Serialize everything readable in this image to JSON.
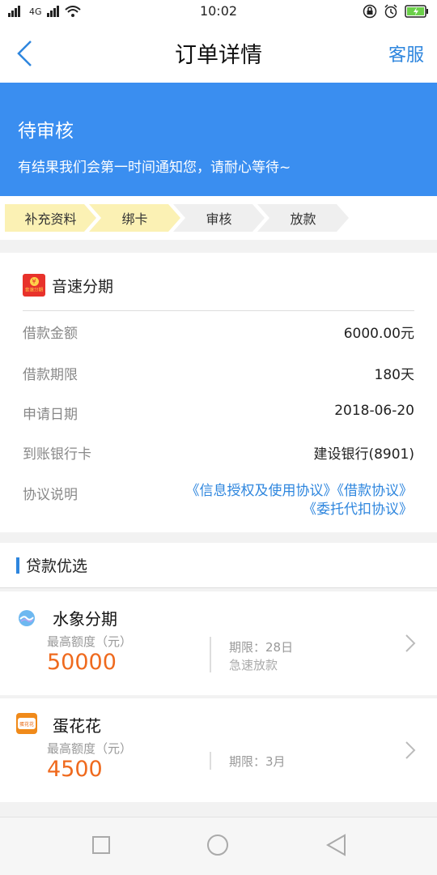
{
  "status_bar": {
    "time": "10:02",
    "network": "4G",
    "icons": [
      "signal-icon",
      "wifi-icon",
      "lock-rotation-icon",
      "alarm-icon",
      "battery-icon"
    ]
  },
  "nav": {
    "back_icon": "chevron-left-icon",
    "title": "订单详情",
    "service": "客服"
  },
  "banner": {
    "title": "待审核",
    "subtitle": "有结果我们会第一时间通知您，请耐心等待~",
    "color": "#3a8ef0"
  },
  "steps": [
    {
      "label": "补充资料",
      "done": true
    },
    {
      "label": "绑卡",
      "done": true
    },
    {
      "label": "审核",
      "done": false
    },
    {
      "label": "放款",
      "done": false
    }
  ],
  "order": {
    "brand_logo_text": "音速分期",
    "brand_name": "音速分期",
    "rows": [
      {
        "key": "借款金额",
        "value": "6000.00元"
      },
      {
        "key": "借款期限",
        "value": "180天"
      },
      {
        "key": "申请日期",
        "value": "2018-06-20"
      },
      {
        "key": "到账银行卡",
        "value": "建设银行(8901)"
      }
    ],
    "agreement_label": "协议说明",
    "agreement_line1": "《信息授权及使用协议》《借款协议》",
    "agreement_line2": "《委托代扣协议》"
  },
  "recommend": {
    "title": "贷款优选",
    "items": [
      {
        "name": "水象分期",
        "icon": "shuixiang-logo-icon",
        "limit_label": "最高额度（元）",
        "amount": "50000",
        "term": "期限：28日",
        "tag": "急速放款"
      },
      {
        "name": "蛋花花",
        "icon": "danhuahua-logo-icon",
        "icon_text": "蛋花花",
        "limit_label": "最高额度（元）",
        "amount": "4500",
        "term": "期限：3月"
      }
    ]
  },
  "colors": {
    "accent": "#2e86de",
    "amount": "#ef6a1e",
    "step_done": "#fbf1b4",
    "step_todo": "#efefef"
  }
}
